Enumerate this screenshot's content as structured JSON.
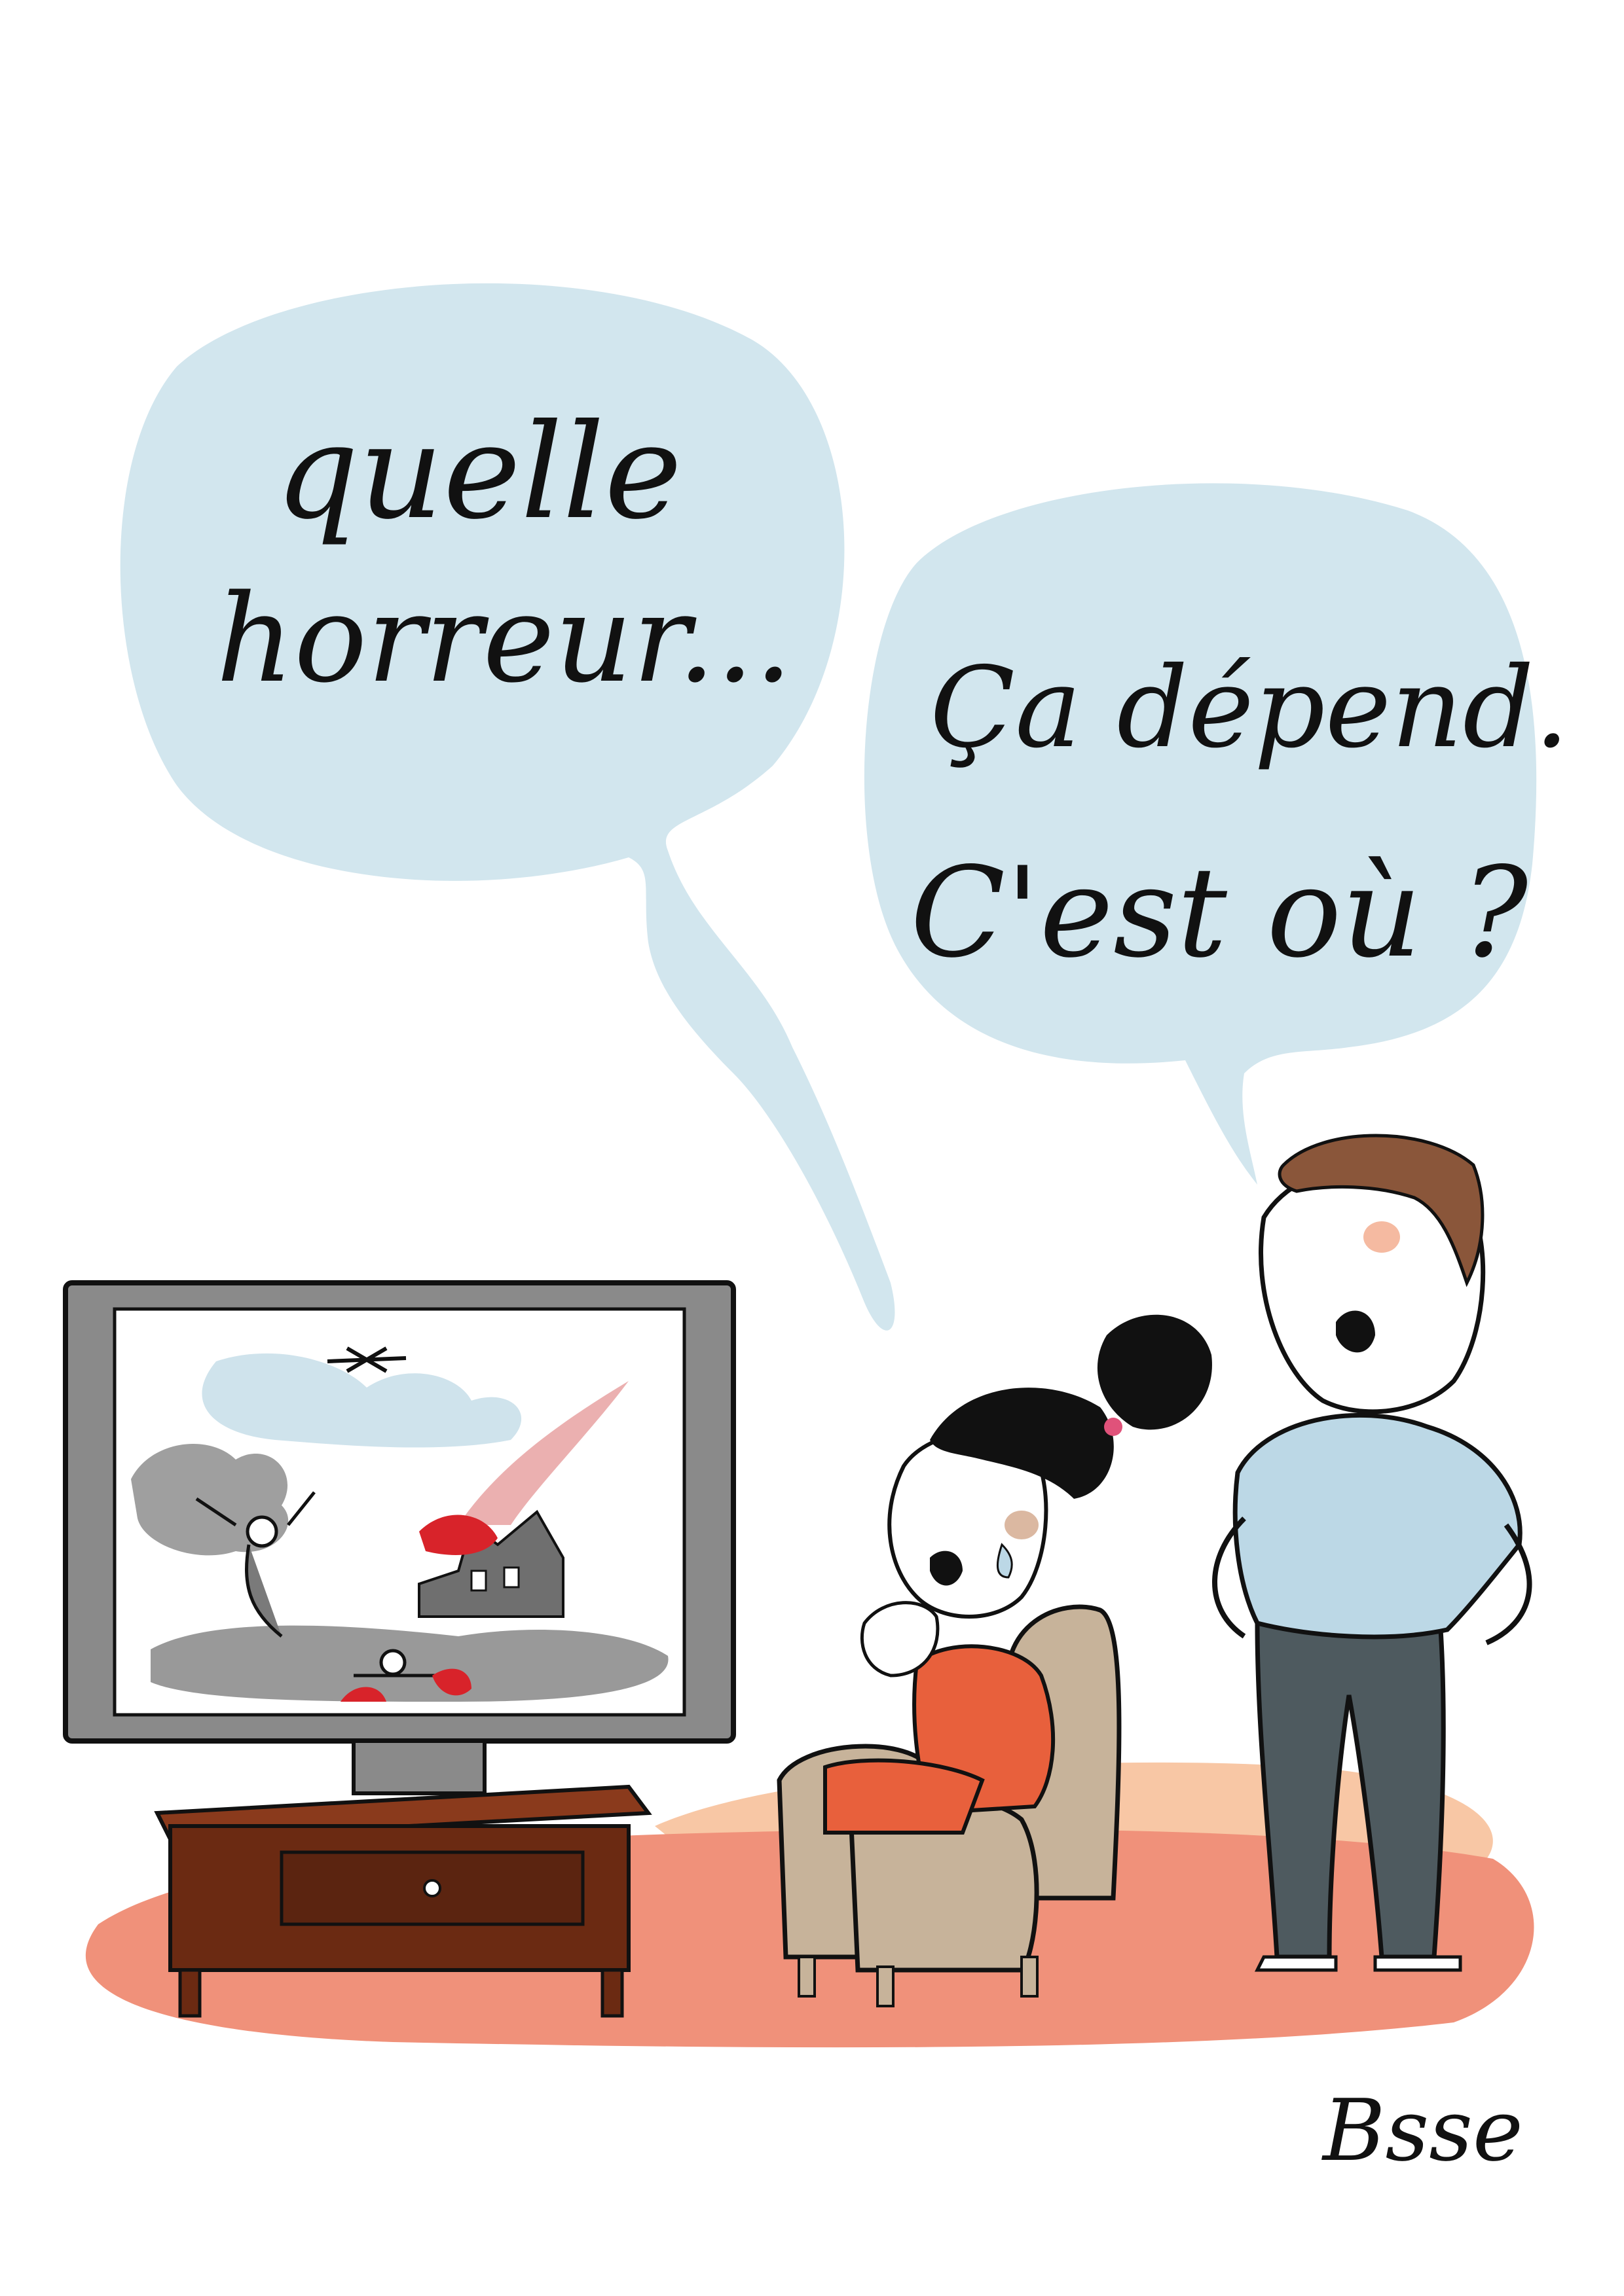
{
  "speech": {
    "left_bubble": {
      "line1": "quelle",
      "line2": "horreur..."
    },
    "right_bubble": {
      "line1": "Ça dépend.",
      "line2": "C'est où ?"
    }
  },
  "signature": "Bsse",
  "colors": {
    "bubble": "#d2e6ee",
    "rug": "#f0917a",
    "rug_light": "#f8c7a5",
    "shirt": "#bcd8e6",
    "trousers": "#4e5a5f",
    "hair_man": "#8a563a",
    "hair_woman": "#111111",
    "armchair": "#c7b39a",
    "dress": "#e8603c",
    "tv_frame": "#8a8a8a",
    "tv_cabinet": "#6b2a12",
    "smoke": "#8e8e8e",
    "blood": "#d8232a",
    "sky_clouds": "#cfe3ec"
  }
}
